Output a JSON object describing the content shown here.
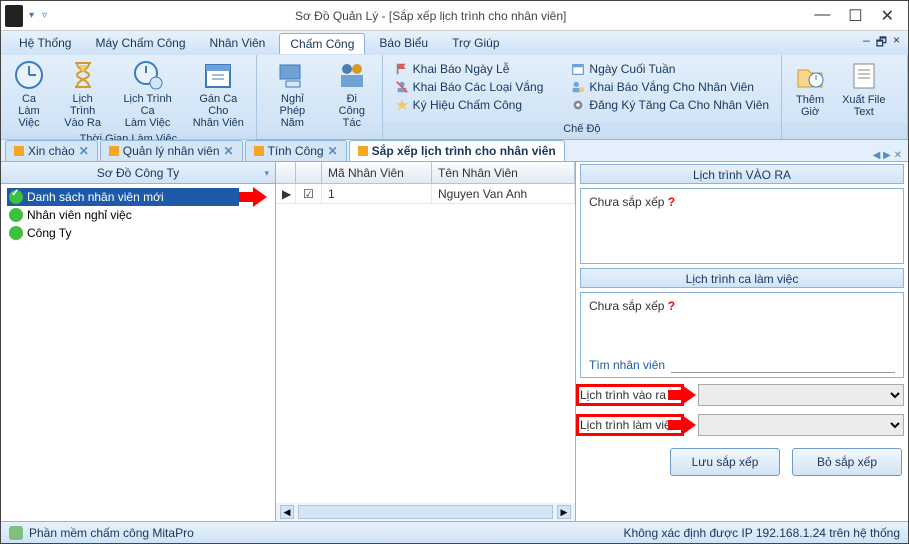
{
  "window": {
    "title": "Sơ Đồ Quản Lý - [Sắp xếp lịch trình cho nhân viên]",
    "min": "—",
    "max": "☐",
    "close": "✕"
  },
  "menu": {
    "items": [
      "Hệ Thống",
      "Máy Chấm Công",
      "Nhân Viên",
      "Chấm Công",
      "Báo Biểu",
      "Trợ Giúp"
    ],
    "active_index": 3
  },
  "ribbon": {
    "group1_label": "Thời Gian Làm Việc",
    "group1_buttons": [
      {
        "label": "Ca Làm\nViệc"
      },
      {
        "label": "Lịch Trình\nVào Ra"
      },
      {
        "label": "Lịch Trình Ca\nLàm Việc"
      },
      {
        "label": "Gán Ca Cho\nNhân Viên"
      }
    ],
    "group2_buttons": [
      {
        "label": "Nghỉ Phép\nNăm"
      },
      {
        "label": "Đi Công\nTác"
      }
    ],
    "group3_label": "Chế Độ",
    "group3_items_left": [
      "Khai Báo Ngày Lễ",
      "Khai Báo Các Loại Vắng",
      "Ký Hiệu Chấm Công"
    ],
    "group3_items_right": [
      "Ngày Cuối Tuần",
      "Khai Báo Vắng Cho Nhân Viên",
      "Đăng Ký Tăng Ca Cho Nhân Viên"
    ],
    "group4_buttons": [
      {
        "label": "Thêm\nGiờ"
      },
      {
        "label": "Xuất File\nText"
      }
    ]
  },
  "doctabs": {
    "items": [
      "Xin chào",
      "Quản lý nhân viên",
      "Tính Công",
      "Sắp xếp lịch trình cho nhân viên"
    ],
    "active_index": 3
  },
  "sidebar": {
    "title": "Sơ Đồ Công Ty",
    "items": [
      {
        "label": "Danh sách nhân viên mới",
        "dot": "greencheck",
        "selected": true
      },
      {
        "label": "Nhân viên nghỉ việc",
        "dot": "green",
        "selected": false
      },
      {
        "label": "Công Ty",
        "dot": "green",
        "selected": false
      }
    ]
  },
  "grid": {
    "headers": {
      "id": "Mã Nhân Viên",
      "name": "Tên Nhân Viên"
    },
    "rows": [
      {
        "checked": true,
        "id": "1",
        "name": "Nguyen Van Anh"
      }
    ]
  },
  "right": {
    "section1_title": "Lịch trình VÀO RA",
    "section1_text": "Chưa sắp xếp",
    "section2_title": "Lịch trình ca làm việc",
    "section2_text": "Chưa sắp xếp",
    "search_label": "Tìm nhân viên",
    "search_value": "",
    "row1_label": "Lịch trình vào ra",
    "row2_label": "Lịch trình làm việc",
    "btn_save": "Lưu sắp xếp",
    "btn_cancel": "Bỏ sắp xếp"
  },
  "status": {
    "left": "Phần mềm chấm công MitaPro",
    "right": "Không xác định được IP 192.168.1.24 trên hệ thống"
  }
}
